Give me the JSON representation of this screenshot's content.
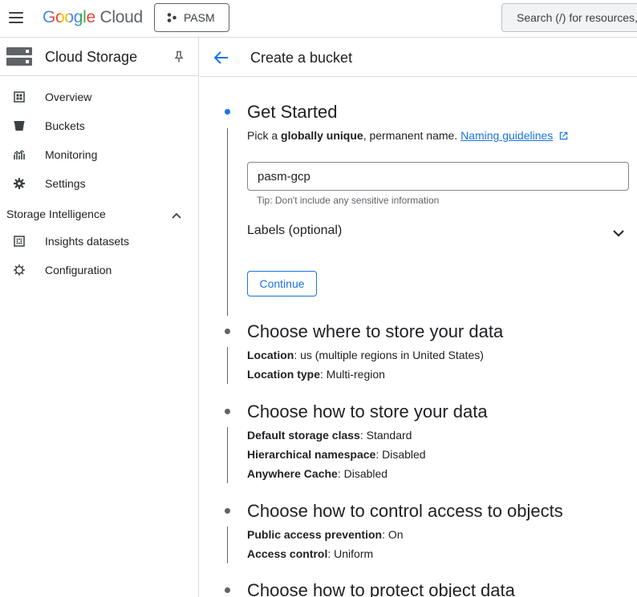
{
  "topbar": {
    "logo_google": "Google",
    "logo_cloud": "Cloud",
    "project_label": "PASM",
    "search_placeholder": "Search (/) for resources,"
  },
  "sidebar": {
    "title": "Cloud Storage",
    "items": [
      {
        "label": "Overview",
        "icon": "overview-icon"
      },
      {
        "label": "Buckets",
        "icon": "bucket-icon"
      },
      {
        "label": "Monitoring",
        "icon": "monitoring-icon"
      },
      {
        "label": "Settings",
        "icon": "gear-icon"
      }
    ],
    "section": "Storage Intelligence",
    "section_items": [
      {
        "label": "Insights datasets",
        "icon": "dataset-icon"
      },
      {
        "label": "Configuration",
        "icon": "configuration-icon"
      }
    ]
  },
  "main": {
    "title": "Create a bucket",
    "steps": [
      {
        "title": "Get Started",
        "intro_pre": "Pick a ",
        "intro_bold": "globally unique",
        "intro_post": ", permanent name.",
        "link": "Naming guidelines",
        "input_value": "pasm-gcp",
        "tip": "Tip: Don't include any sensitive information",
        "labels": "Labels (optional)",
        "continue": "Continue"
      },
      {
        "title": "Choose where to store your data",
        "rows": [
          {
            "key": "Location",
            "value": ": us (multiple regions in United States)"
          },
          {
            "key": "Location type",
            "value": ": Multi-region"
          }
        ]
      },
      {
        "title": "Choose how to store your data",
        "rows": [
          {
            "key": "Default storage class",
            "value": ": Standard"
          },
          {
            "key": "Hierarchical namespace",
            "value": ": Disabled"
          },
          {
            "key": "Anywhere Cache",
            "value": ": Disabled"
          }
        ]
      },
      {
        "title": "Choose how to control access to objects",
        "rows": [
          {
            "key": "Public access prevention",
            "value": ": On"
          },
          {
            "key": "Access control",
            "value": ": Uniform"
          }
        ]
      },
      {
        "title": "Choose how to protect object data"
      }
    ]
  },
  "colors": {
    "accent": "#1a73e8",
    "text": "#202124",
    "muted": "#5f6368",
    "border": "#dadce0"
  }
}
